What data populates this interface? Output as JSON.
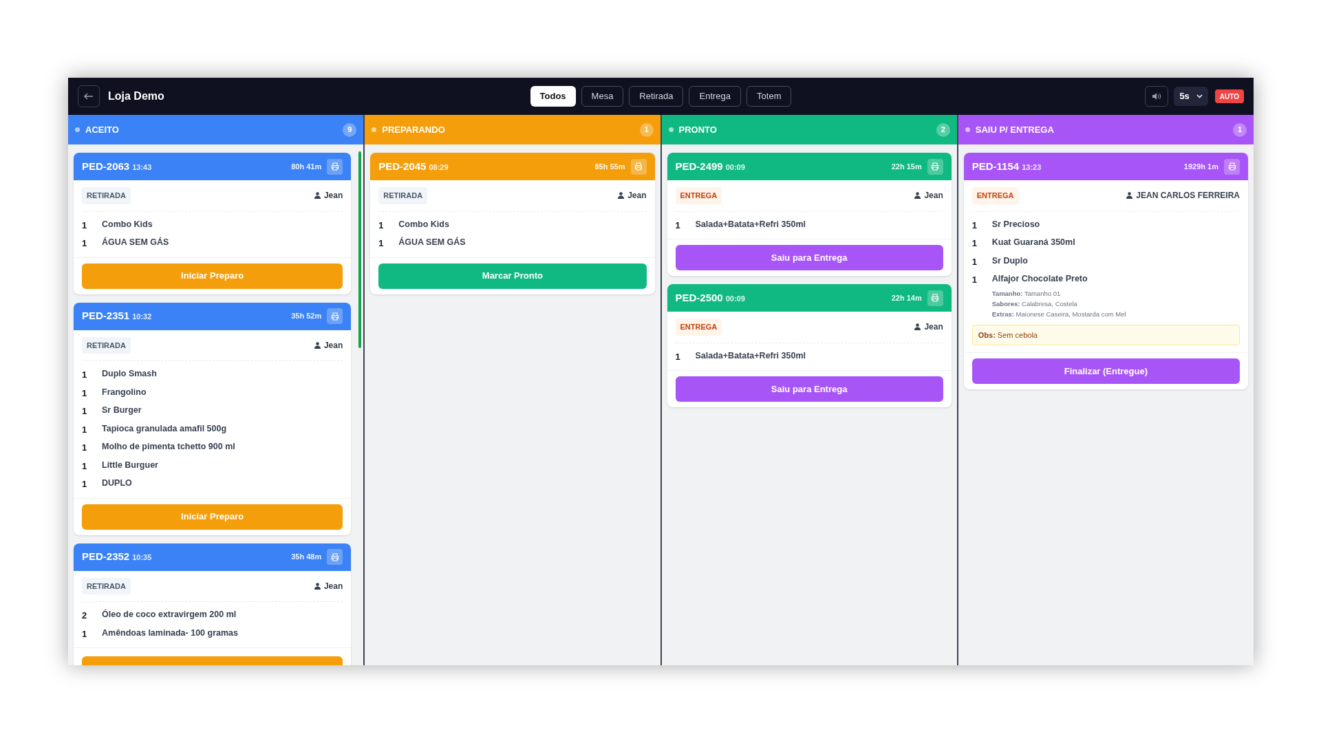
{
  "header": {
    "title": "Loja Demo",
    "filters": [
      {
        "label": "Todos",
        "selected": true
      },
      {
        "label": "Mesa",
        "selected": false
      },
      {
        "label": "Retirada",
        "selected": false
      },
      {
        "label": "Entrega",
        "selected": false
      },
      {
        "label": "Totem",
        "selected": false
      }
    ],
    "interval": "5s",
    "auto_badge": "AUTO"
  },
  "columns": [
    {
      "title": "ACEITO",
      "count": "9",
      "color": "#3b82f6",
      "scrollable": true,
      "cards": [
        {
          "id": "PED-2063",
          "time": "13:43",
          "elapsed": "80h 41m",
          "type": {
            "label": "RETIRADA",
            "kind": "pickup"
          },
          "customer": "Jean",
          "items": [
            {
              "qty": "1",
              "name": "Combo Kids"
            },
            {
              "qty": "1",
              "name": "ÁGUA SEM GÁS"
            }
          ],
          "action": {
            "label": "Iniciar Preparo",
            "color": "#f59e0b"
          }
        },
        {
          "id": "PED-2351",
          "time": "10:32",
          "elapsed": "35h 52m",
          "type": {
            "label": "RETIRADA",
            "kind": "pickup"
          },
          "customer": "Jean",
          "items": [
            {
              "qty": "1",
              "name": "Duplo Smash"
            },
            {
              "qty": "1",
              "name": "Frangolino"
            },
            {
              "qty": "1",
              "name": "Sr Burger"
            },
            {
              "qty": "1",
              "name": "Tapioca granulada amafil 500g"
            },
            {
              "qty": "1",
              "name": "Molho de pimenta tchetto 900 ml"
            },
            {
              "qty": "1",
              "name": "Little Burguer"
            },
            {
              "qty": "1",
              "name": "DUPLO"
            }
          ],
          "action": {
            "label": "Iniciar Preparo",
            "color": "#f59e0b"
          }
        },
        {
          "id": "PED-2352",
          "time": "10:35",
          "elapsed": "35h 48m",
          "type": {
            "label": "RETIRADA",
            "kind": "pickup"
          },
          "customer": "Jean",
          "items": [
            {
              "qty": "2",
              "name": "Óleo de coco extravirgem 200 ml"
            },
            {
              "qty": "1",
              "name": "Amêndoas laminada- 100 gramas"
            }
          ],
          "action": {
            "color": "#f59e0b"
          }
        }
      ]
    },
    {
      "title": "PREPARANDO",
      "count": "1",
      "color": "#f59e0b",
      "cards": [
        {
          "id": "PED-2045",
          "time": "08:29",
          "elapsed": "85h 55m",
          "type": {
            "label": "RETIRADA",
            "kind": "pickup"
          },
          "customer": "Jean",
          "items": [
            {
              "qty": "1",
              "name": "Combo Kids"
            },
            {
              "qty": "1",
              "name": "ÁGUA SEM GÁS"
            }
          ],
          "action": {
            "label": "Marcar Pronto",
            "color": "#10b981"
          }
        }
      ]
    },
    {
      "title": "PRONTO",
      "count": "2",
      "color": "#10b981",
      "cards": [
        {
          "id": "PED-2499",
          "time": "00:09",
          "elapsed": "22h 15m",
          "type": {
            "label": "ENTREGA",
            "kind": "delivery"
          },
          "customer": "Jean",
          "items": [
            {
              "qty": "1",
              "name": "Salada+Batata+Refri 350ml"
            }
          ],
          "action": {
            "label": "Saiu para Entrega",
            "color": "#a855f7"
          }
        },
        {
          "id": "PED-2500",
          "time": "00:09",
          "elapsed": "22h 14m",
          "type": {
            "label": "ENTREGA",
            "kind": "delivery"
          },
          "customer": "Jean",
          "items": [
            {
              "qty": "1",
              "name": "Salada+Batata+Refri 350ml"
            }
          ],
          "action": {
            "label": "Saiu para Entrega",
            "color": "#a855f7"
          }
        }
      ]
    },
    {
      "title": "SAIU P/ ENTREGA",
      "count": "1",
      "color": "#a855f7",
      "cards": [
        {
          "id": "PED-1154",
          "time": "13:23",
          "elapsed": "1929h 1m",
          "type": {
            "label": "ENTREGA",
            "kind": "delivery"
          },
          "customer": "JEAN CARLOS FERREIRA",
          "items": [
            {
              "qty": "1",
              "name": "Sr Precioso"
            },
            {
              "qty": "1",
              "name": "Kuat Guaraná 350ml"
            },
            {
              "qty": "1",
              "name": "Sr Duplo"
            },
            {
              "qty": "1",
              "name": "Alfajor Chocolate Preto",
              "details": [
                "**Tamanho:** Tamanho 01",
                "**Sabores:** Calabresa, Costela",
                "**Extras:** Maionese Caseira, Mostarda com Mel"
              ]
            }
          ],
          "note": "**Obs:** Sem cebola",
          "action": {
            "label": "Finalizar (Entregue)",
            "color": "#a855f7"
          }
        }
      ]
    }
  ]
}
